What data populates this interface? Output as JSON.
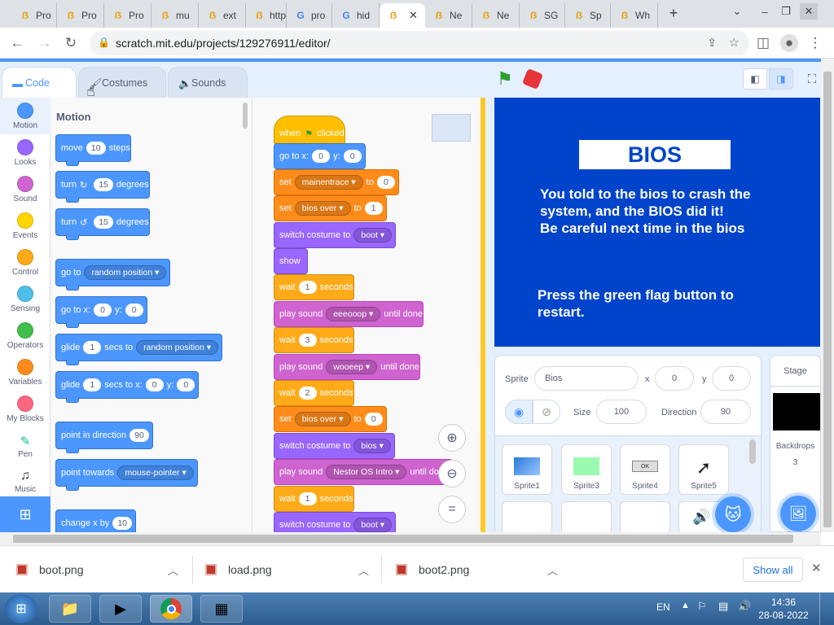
{
  "browser": {
    "tabs": [
      {
        "title": "Pro",
        "icon": "scratch"
      },
      {
        "title": "Pro",
        "icon": "scratch"
      },
      {
        "title": "Pro",
        "icon": "scratch"
      },
      {
        "title": "mu",
        "icon": "scratch"
      },
      {
        "title": "ext",
        "icon": "scratch"
      },
      {
        "title": "http",
        "icon": "scratch"
      },
      {
        "title": "pro",
        "icon": "google"
      },
      {
        "title": "hid",
        "icon": "google"
      },
      {
        "title": "",
        "icon": "scratch",
        "active": true
      },
      {
        "title": "Ne",
        "icon": "scratch"
      },
      {
        "title": "Ne",
        "icon": "scratch"
      },
      {
        "title": "SG",
        "icon": "scratch"
      },
      {
        "title": "Sp",
        "icon": "scratch"
      },
      {
        "title": "Wh",
        "icon": "scratch"
      }
    ],
    "url": "scratch.mit.edu/projects/129276911/editor/"
  },
  "editor": {
    "tabs": {
      "code": "Code",
      "costumes": "Costumes",
      "sounds": "Sounds"
    },
    "categories": [
      {
        "label": "Motion",
        "color": "#4c97ff"
      },
      {
        "label": "Looks",
        "color": "#9966ff"
      },
      {
        "label": "Sound",
        "color": "#cf63cf"
      },
      {
        "label": "Events",
        "color": "#ffd500"
      },
      {
        "label": "Control",
        "color": "#ffab19"
      },
      {
        "label": "Sensing",
        "color": "#4cbfe6"
      },
      {
        "label": "Operators",
        "color": "#40bf4a"
      },
      {
        "label": "Variables",
        "color": "#ff8c1a"
      },
      {
        "label": "My Blocks",
        "color": "#ff6680"
      },
      {
        "label": "Pen",
        "color": ""
      },
      {
        "label": "Music",
        "color": ""
      }
    ],
    "palette": {
      "heading": "Motion",
      "move": {
        "a": "move",
        "v": "10",
        "b": "steps"
      },
      "turn_right": {
        "a": "turn",
        "v": "15",
        "b": "degrees"
      },
      "turn_left": {
        "a": "turn",
        "v": "15",
        "b": "degrees"
      },
      "goto": {
        "a": "go to",
        "dd": "random position"
      },
      "goto_xy": {
        "a": "go to x:",
        "x": "0",
        "b": "y:",
        "y": "0"
      },
      "glide": {
        "a": "glide",
        "v": "1",
        "b": "secs to",
        "dd": "random position"
      },
      "glide_xy": {
        "a": "glide",
        "v": "1",
        "b": "secs to x:",
        "x": "0",
        "c": "y:",
        "y": "0"
      },
      "point_dir": {
        "a": "point in direction",
        "v": "90"
      },
      "point_towards": {
        "a": "point towards",
        "dd": "mouse-pointer"
      },
      "change_x": {
        "a": "change x by",
        "v": "10"
      }
    },
    "script": {
      "hat": {
        "a": "when",
        "b": "clicked"
      },
      "b1": {
        "a": "go to x:",
        "x": "0",
        "b": "y:",
        "y": "0"
      },
      "b2": {
        "a": "set",
        "dd": "mainentrace",
        "b": "to",
        "v": "0"
      },
      "b3": {
        "a": "set",
        "dd": "bios over",
        "b": "to",
        "v": "1"
      },
      "b4": {
        "a": "switch costume to",
        "dd": "boot"
      },
      "b5": {
        "a": "show"
      },
      "b6": {
        "a": "wait",
        "v": "1",
        "b": "seconds"
      },
      "b7": {
        "a": "play sound",
        "dd": "eeeooop",
        "b": "until done"
      },
      "b8": {
        "a": "wait",
        "v": "3",
        "b": "seconds"
      },
      "b9": {
        "a": "play sound",
        "dd": "wooeep",
        "b": "until done"
      },
      "b10": {
        "a": "wait",
        "v": "2",
        "b": "seconds"
      },
      "b11": {
        "a": "set",
        "dd": "bios over",
        "b": "to",
        "v": "0"
      },
      "b12": {
        "a": "switch costume to",
        "dd": "bios"
      },
      "b13": {
        "a": "play sound",
        "dd": "Nestor OS Intro",
        "b": "until do"
      },
      "b14": {
        "a": "wait",
        "v": "1",
        "b": "seconds"
      },
      "b15": {
        "a": "switch costume to",
        "dd": "boot"
      }
    },
    "stage": {
      "title": "BIOS",
      "msg1": "You told to the bios to crash the",
      "msg2": "system, and the BIOS did it!",
      "msg3": "Be careful next time in the bios",
      "msg4": "Press the green flag button to",
      "msg5": "restart."
    },
    "sprite_info": {
      "sprite_label": "Sprite",
      "name": "Bios",
      "x_label": "x",
      "x": "0",
      "y_label": "y",
      "y": "0",
      "show_label": "Show",
      "size_label": "Size",
      "size": "100",
      "direction_label": "Direction",
      "direction": "90"
    },
    "sprites": [
      "Sprite1",
      "Sprite3",
      "Sprite4",
      "Sprite5"
    ],
    "sprite4_text": "OK",
    "stage_panel": {
      "label": "Stage",
      "backdrops_label": "Backdrops",
      "backdrops_count": "3"
    }
  },
  "downloads": {
    "items": [
      "boot.png",
      "load.png",
      "boot2.png"
    ],
    "show_all": "Show all"
  },
  "taskbar": {
    "lang": "EN",
    "time": "14:36",
    "date": "28-08-2022"
  }
}
